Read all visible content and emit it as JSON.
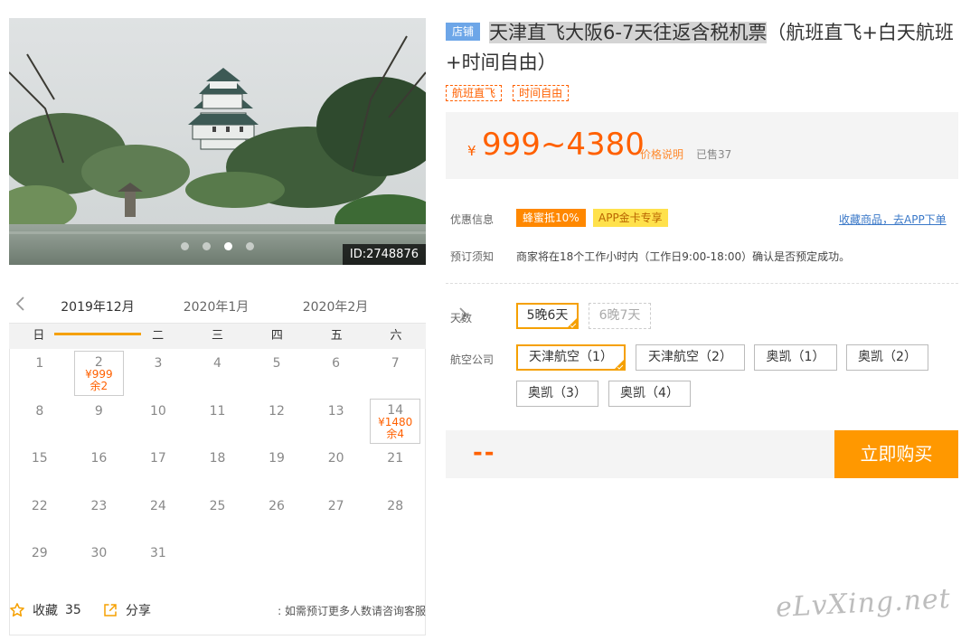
{
  "gallery": {
    "photo_id": "ID:2748876",
    "dot_count": 4,
    "active_dot": 2
  },
  "calendar": {
    "months": [
      "2019年12月",
      "2020年1月",
      "2020年2月"
    ],
    "active_month": 0,
    "weekdays": [
      "日",
      "一",
      "二",
      "三",
      "四",
      "五",
      "六"
    ],
    "days": [
      {
        "d": "1"
      },
      {
        "d": "2",
        "price": "¥999",
        "stock": "余2"
      },
      {
        "d": "3"
      },
      {
        "d": "4"
      },
      {
        "d": "5"
      },
      {
        "d": "6"
      },
      {
        "d": "7"
      },
      {
        "d": "8"
      },
      {
        "d": "9"
      },
      {
        "d": "10"
      },
      {
        "d": "11"
      },
      {
        "d": "12"
      },
      {
        "d": "13"
      },
      {
        "d": "14",
        "price": "¥1480",
        "stock": "余4"
      },
      {
        "d": "15"
      },
      {
        "d": "16"
      },
      {
        "d": "17"
      },
      {
        "d": "18"
      },
      {
        "d": "19"
      },
      {
        "d": "20"
      },
      {
        "d": "21"
      },
      {
        "d": "22"
      },
      {
        "d": "23"
      },
      {
        "d": "24"
      },
      {
        "d": "25"
      },
      {
        "d": "26"
      },
      {
        "d": "27"
      },
      {
        "d": "28"
      },
      {
        "d": "29"
      },
      {
        "d": "30"
      },
      {
        "d": "31"
      }
    ]
  },
  "footer": {
    "favorite_label": "收藏",
    "favorite_count": "35",
    "share_label": "分享",
    "consult_text": "如需预订更多人数请咨询客服"
  },
  "product": {
    "shop_badge": "店铺",
    "title_highlight": "天津直飞大阪6-7天往返含税机票",
    "title_rest": "（航班直飞+白天航班+时间自由）",
    "tags": [
      "航班直飞",
      "时间自由"
    ],
    "price_symbol": "¥",
    "price_range": "999~4380",
    "price_explain": "价格说明",
    "sold": "已售37"
  },
  "discount": {
    "label": "优惠信息",
    "promo": "蜂蜜抵10%",
    "app_gold": "APP金卡专享",
    "app_link": "收藏商品，去APP下单"
  },
  "booking_notice": {
    "label": "预订须知",
    "text": "商家将在18个工作小时内（工作日9:00-18:00）确认是否预定成功。"
  },
  "options": {
    "days_label": "天数",
    "days": [
      {
        "label": "5晚6天",
        "state": "selected"
      },
      {
        "label": "6晚7天",
        "state": "disabled"
      }
    ],
    "airline_label": "航空公司",
    "airlines": [
      {
        "label": "天津航空（1）",
        "state": "selected"
      },
      {
        "label": "天津航空（2）",
        "state": "normal"
      },
      {
        "label": "奥凯（1）",
        "state": "normal"
      },
      {
        "label": "奥凯（2）",
        "state": "normal"
      },
      {
        "label": "奥凯（3）",
        "state": "normal"
      },
      {
        "label": "奥凯（4）",
        "state": "normal"
      }
    ]
  },
  "buy": {
    "total": "--",
    "button": "立即购买"
  },
  "watermark": "eLvXing.net",
  "colors": {
    "accent_orange": "#ff6000",
    "button_orange": "#ff9800",
    "select_border": "#f5a000",
    "shop_badge_blue": "#6da6e8",
    "link_blue": "#3a78c8"
  }
}
